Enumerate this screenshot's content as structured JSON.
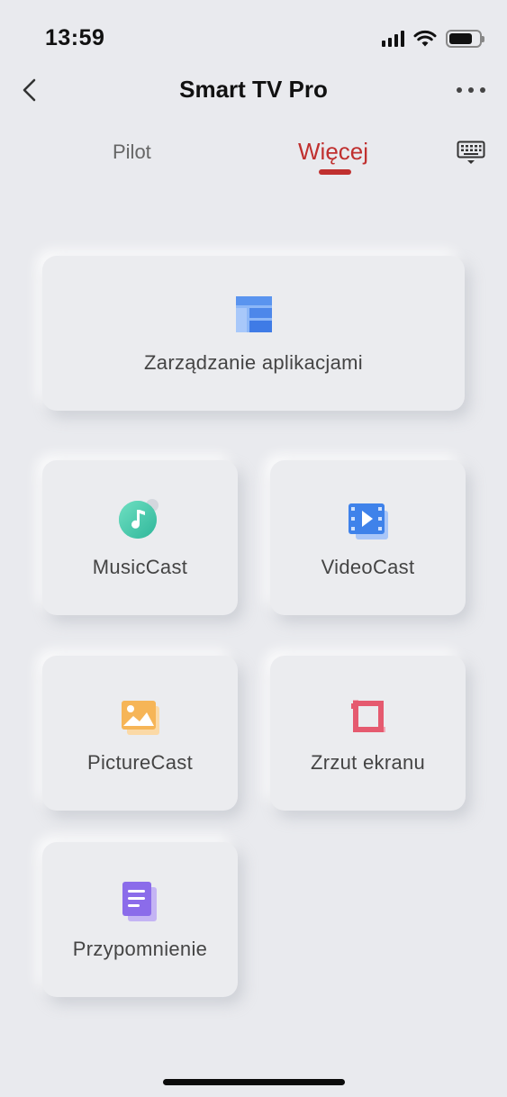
{
  "status_bar": {
    "time": "13:59"
  },
  "header": {
    "title": "Smart TV Pro"
  },
  "tabs": [
    {
      "label": "Pilot",
      "active": false
    },
    {
      "label": "Więcej",
      "active": true
    }
  ],
  "colors": {
    "accent": "#c0302f",
    "background": "#e9eaee"
  },
  "features": {
    "app_manager": {
      "label": "Zarządzanie aplikacjami",
      "icon": "app-grid-icon"
    },
    "music_cast": {
      "label": "MusicCast",
      "icon": "music-note-icon"
    },
    "video_cast": {
      "label": "VideoCast",
      "icon": "video-play-icon"
    },
    "picture_cast": {
      "label": "PictureCast",
      "icon": "picture-icon"
    },
    "screenshot": {
      "label": "Zrzut ekranu",
      "icon": "crop-icon"
    },
    "reminder": {
      "label": "Przypomnienie",
      "icon": "document-icon"
    }
  }
}
